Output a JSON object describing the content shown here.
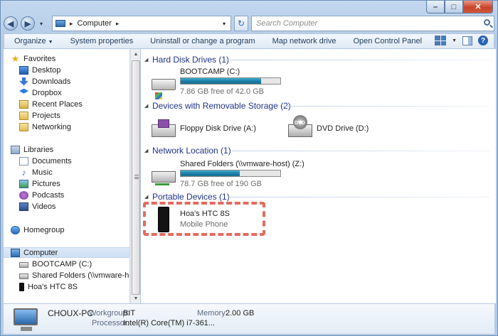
{
  "window": {
    "caption_min": "–",
    "caption_max": "□",
    "caption_close": "✕"
  },
  "nav": {
    "back_glyph": "◀",
    "forward_glyph": "▶",
    "recent_glyph": "▾",
    "address_sep": "▸",
    "address": "Computer",
    "address_after": "▸",
    "address_drop": "▾",
    "refresh_glyph": "↻",
    "search_placeholder": "Search Computer"
  },
  "toolbar": {
    "organize": "Organize",
    "organize_caret": "▼",
    "system_properties": "System properties",
    "uninstall": "Uninstall or change a program",
    "map_drive": "Map network drive",
    "control_panel": "Open Control Panel",
    "views_caret": "▼",
    "help": "?"
  },
  "sidebar": {
    "favorites": {
      "label": "Favorites",
      "items": [
        {
          "label": "Desktop",
          "icon": "desktop-icon"
        },
        {
          "label": "Downloads",
          "icon": "downloads-icon"
        },
        {
          "label": "Dropbox",
          "icon": "dropbox-icon"
        },
        {
          "label": "Recent Places",
          "icon": "recent-places-icon"
        },
        {
          "label": "Projects",
          "icon": "folder-icon"
        },
        {
          "label": "Networking",
          "icon": "folder-icon"
        }
      ]
    },
    "libraries": {
      "label": "Libraries",
      "items": [
        {
          "label": "Documents",
          "icon": "documents-icon"
        },
        {
          "label": "Music",
          "icon": "music-icon"
        },
        {
          "label": "Pictures",
          "icon": "pictures-icon"
        },
        {
          "label": "Podcasts",
          "icon": "podcasts-icon"
        },
        {
          "label": "Videos",
          "icon": "videos-icon"
        }
      ]
    },
    "homegroup": {
      "label": "Homegroup"
    },
    "computer": {
      "label": "Computer",
      "items": [
        {
          "label": "BOOTCAMP (C:)",
          "icon": "drive-icon"
        },
        {
          "label": "Shared Folders (\\\\vmware-host) (Z:)",
          "icon": "network-drive-icon"
        },
        {
          "label": "Hoa's HTC 8S",
          "icon": "phone-icon"
        }
      ]
    },
    "scroll_up": "▲",
    "scroll_down": "▼"
  },
  "groups": {
    "hdd": {
      "title": "Hard Disk Drives (1)"
    },
    "removable": {
      "title": "Devices with Removable Storage (2)"
    },
    "network": {
      "title": "Network Location (1)"
    },
    "portable": {
      "title": "Portable Devices (1)"
    },
    "expand_glyph": "◢"
  },
  "drives": {
    "bootcamp": {
      "name": "BOOTCAMP (C:)",
      "free": "7.86 GB free of 42.0 GB",
      "used_fraction": 0.81
    },
    "floppy": {
      "name": "Floppy Disk Drive (A:)"
    },
    "dvd": {
      "name": "DVD Drive (D:)",
      "badge": "DVD"
    },
    "shared": {
      "name": "Shared Folders (\\\\vmware-host) (Z:)",
      "free": "78.7 GB free of 190 GB",
      "used_fraction": 0.59
    },
    "phone": {
      "name": "Hoa's HTC 8S",
      "type": "Mobile Phone"
    }
  },
  "details": {
    "name": "CHOUX-PC",
    "workgroup_label": "Workgroup:",
    "workgroup": "BIT",
    "memory_label": "Memory:",
    "memory": "2.00 GB",
    "processor_label": "Processor:",
    "processor": "Intel(R) Core(TM) i7-361..."
  },
  "colors": {
    "accent": "#1e3287",
    "capacity_bar": "#1d7fa8",
    "highlight_border": "#e46a5e"
  }
}
